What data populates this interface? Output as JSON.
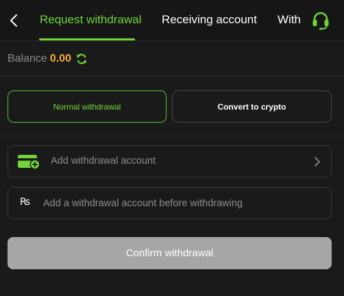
{
  "header": {
    "tabs": [
      {
        "label": "Request withdrawal",
        "active": true
      },
      {
        "label": "Receiving account",
        "active": false
      },
      {
        "label": "With",
        "active": false
      }
    ],
    "back_icon": "chevron-left-icon",
    "support_icon": "headset-icon"
  },
  "balance": {
    "label": "Balance",
    "value": "0.00",
    "refresh_icon": "refresh-icon"
  },
  "withdrawal_modes": {
    "normal_label": "Normal withdrawal",
    "crypto_label": "Convert to crypto",
    "selected": "normal"
  },
  "account_field": {
    "icon": "card-add-icon",
    "placeholder": "Add withdrawal account",
    "action_icon": "chevron-right-icon"
  },
  "amount_field": {
    "currency_symbol": "₨",
    "placeholder": "Add a withdrawal account before withdrawing"
  },
  "confirm": {
    "label": "Confirm withdrawal",
    "enabled": false
  },
  "colors": {
    "accent": "#6fd63a",
    "balance": "#f4a93a",
    "background": "#1a1a1b",
    "disabled_button": "#a6a6a6"
  }
}
